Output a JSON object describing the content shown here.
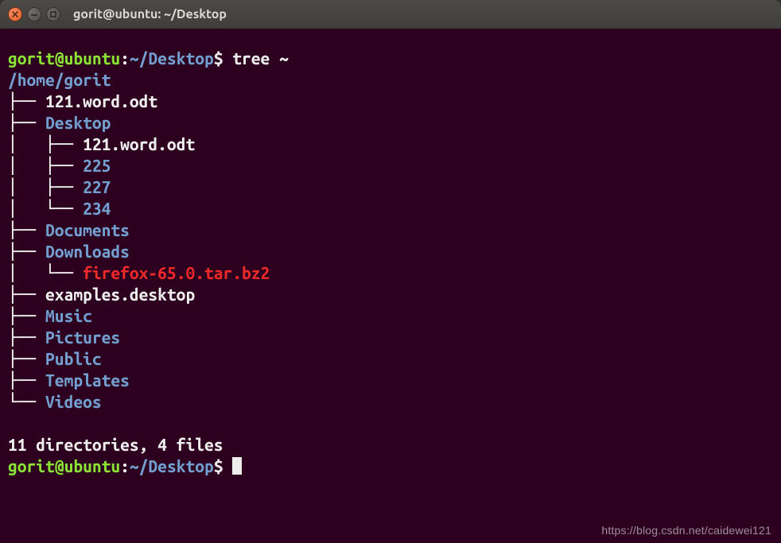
{
  "window": {
    "title": "gorit@ubuntu: ~/Desktop"
  },
  "prompt": {
    "user": "gorit",
    "at": "@",
    "host": "ubuntu",
    "colon": ":",
    "path": "~/Desktop",
    "sigil": "$"
  },
  "command": "tree ~",
  "tree": {
    "root": "/home/gorit",
    "lines": [
      {
        "branch": "├── ",
        "name": "121.word.odt",
        "kind": "plain"
      },
      {
        "branch": "├── ",
        "name": "Desktop",
        "kind": "dir"
      },
      {
        "branch": "│   ├── ",
        "name": "121.word.odt",
        "kind": "plain"
      },
      {
        "branch": "│   ├── ",
        "name": "225",
        "kind": "dir"
      },
      {
        "branch": "│   ├── ",
        "name": "227",
        "kind": "dir"
      },
      {
        "branch": "│   └── ",
        "name": "234",
        "kind": "dir"
      },
      {
        "branch": "├── ",
        "name": "Documents",
        "kind": "dir"
      },
      {
        "branch": "├── ",
        "name": "Downloads",
        "kind": "dir"
      },
      {
        "branch": "│   └── ",
        "name": "firefox-65.0.tar.bz2",
        "kind": "archive"
      },
      {
        "branch": "├── ",
        "name": "examples.desktop",
        "kind": "plain"
      },
      {
        "branch": "├── ",
        "name": "Music",
        "kind": "dir"
      },
      {
        "branch": "├── ",
        "name": "Pictures",
        "kind": "dir"
      },
      {
        "branch": "├── ",
        "name": "Public",
        "kind": "dir"
      },
      {
        "branch": "├── ",
        "name": "Templates",
        "kind": "dir"
      },
      {
        "branch": "└── ",
        "name": "Videos",
        "kind": "dir"
      }
    ]
  },
  "summary": "11 directories, 4 files",
  "watermark": "https://blog.csdn.net/caidewei121"
}
